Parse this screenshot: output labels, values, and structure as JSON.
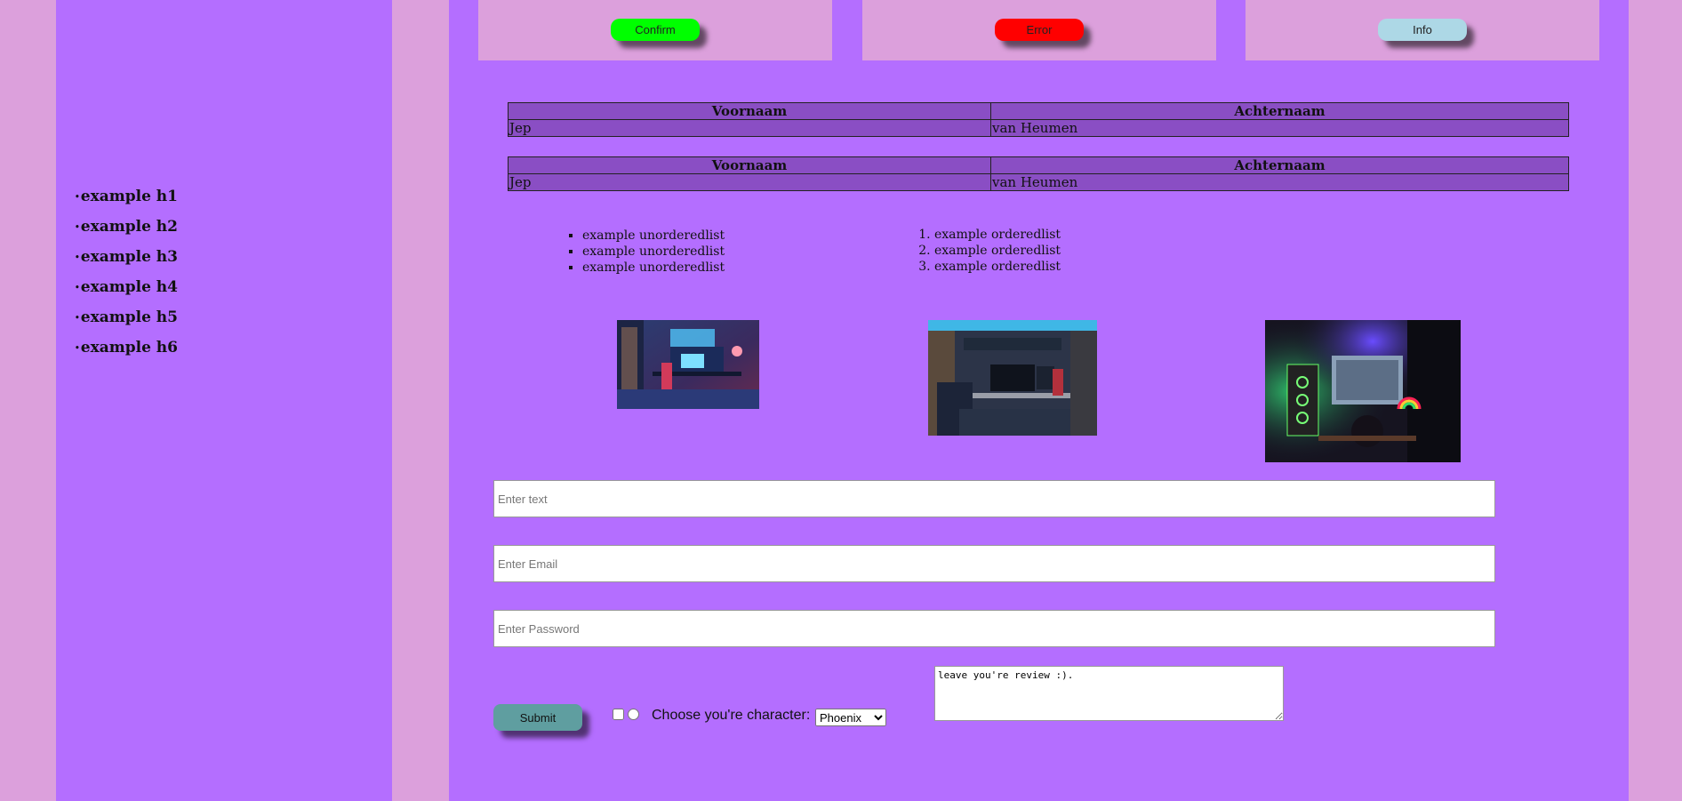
{
  "sidebar": {
    "items": [
      {
        "label": "example h1"
      },
      {
        "label": "example h2"
      },
      {
        "label": "example h3"
      },
      {
        "label": "example h4"
      },
      {
        "label": "example h5"
      },
      {
        "label": "example h6"
      }
    ]
  },
  "buttons": {
    "confirm_label": "Confirm",
    "error_label": "Error",
    "info_label": "Info",
    "confirm_color": "#00ff00",
    "error_color": "#ff0000",
    "info_color": "#add8e6"
  },
  "tables": [
    {
      "headers": [
        "Voornaam",
        "Achternaam"
      ],
      "row": [
        "Jep",
        "van Heumen"
      ]
    },
    {
      "headers": [
        "Voornaam",
        "Achternaam"
      ],
      "row": [
        "Jep",
        "van Heumen"
      ]
    }
  ],
  "unordered_list": [
    "example unorderedlist",
    "example unorderedlist",
    "example unorderedlist"
  ],
  "ordered_list": [
    "example orderedlist",
    "example orderedlist",
    "example orderedlist"
  ],
  "form": {
    "text_placeholder": "Enter text",
    "email_placeholder": "Enter Email",
    "password_placeholder": "Enter Password",
    "submit_label": "Submit",
    "choose_label": "Choose you're character:",
    "character_selected": "Phoenix",
    "review_text": "leave you're review :)."
  }
}
